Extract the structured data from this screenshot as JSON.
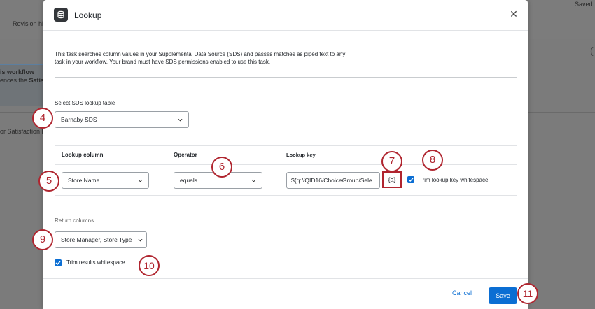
{
  "background": {
    "saved_text": "Saved",
    "revision_text": "Revision his",
    "workflow_heading": "is workflow",
    "workflow_subtext_prefix": "ences the ",
    "workflow_subtext_bold": "Satisf",
    "satisfaction_text": "or Satisfaction D"
  },
  "modal": {
    "title": "Lookup",
    "close_symbol": "✕",
    "description": "This task searches column values in your Supplemental Data Source (SDS) and passes matches as piped text to any task in your workflow. Your brand must have SDS permissions enabled to use this task."
  },
  "sds": {
    "label": "Select SDS lookup table",
    "selected": "Barnaby SDS"
  },
  "lookup": {
    "col_header": "Lookup column",
    "op_header": "Operator",
    "key_header": "Lookup key",
    "column_value": "Store Name",
    "operator_value": "equals",
    "key_value": "${q://QID16/ChoiceGroup/Sele",
    "piped_text_label": "{a}",
    "trim_key_label": "Trim lookup key whitespace"
  },
  "return": {
    "label": "Return columns",
    "selected": "Store Manager, Store Type",
    "trim_label": "Trim results whitespace"
  },
  "footer": {
    "cancel_label": "Cancel",
    "save_label": "Save"
  },
  "callouts": [
    "4",
    "5",
    "6",
    "7",
    "8",
    "9",
    "10",
    "11"
  ],
  "colors": {
    "accent": "#0b6ed3",
    "callout": "#b0252f"
  }
}
